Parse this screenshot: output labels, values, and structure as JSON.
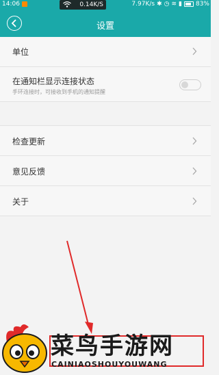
{
  "statusbar": {
    "time": "14:06",
    "speed_pill": "0.14K/S",
    "speed": "7.97K/s",
    "battery": "83%"
  },
  "header": {
    "title": "设置",
    "back_icon": "chevron-left-icon"
  },
  "settings": {
    "unit_label": "单位",
    "notify_label": "在通知栏显示连接状态",
    "notify_desc": "手环连接时，可接收到手机的通知提醒",
    "notify_toggle": "off",
    "update_label": "检查更新",
    "feedback_label": "意见反馈",
    "about_label": "关于"
  },
  "watermark": {
    "text": "菜鸟手游网",
    "sub": "CAINIAOSHOUYOUWANG"
  },
  "colors": {
    "accent": "#1aa9a9",
    "annotation": "#e02a2a"
  }
}
